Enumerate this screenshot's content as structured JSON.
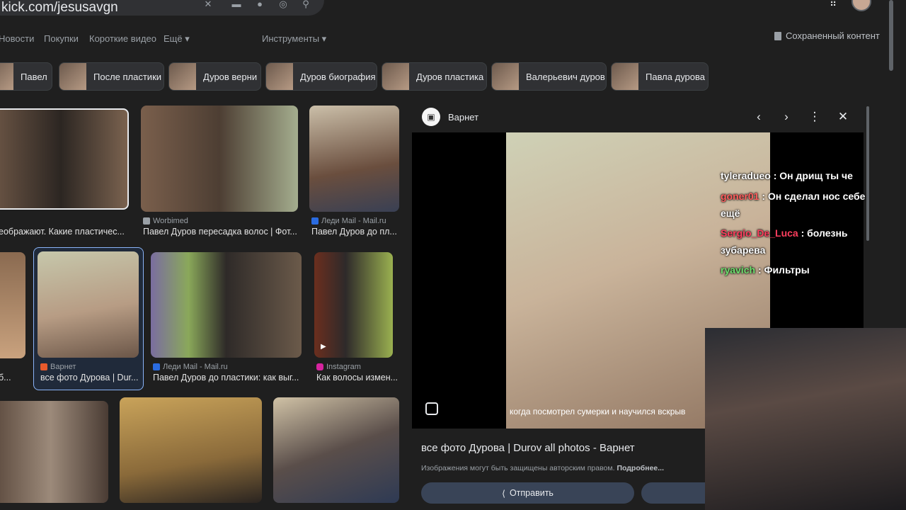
{
  "search": {
    "query": "kick.com/jesusavgn"
  },
  "header": {
    "icons": [
      "clear-icon",
      "keyboard-icon",
      "mic-icon",
      "lens-icon",
      "search-icon",
      "apps-grid-icon"
    ],
    "tabs": [
      "Новости",
      "Покупки",
      "Короткие видео",
      "Ещё ▾",
      "Инструменты ▾"
    ],
    "saved_label": "Сохраненный контент"
  },
  "chips": [
    "Павел",
    "После пластики",
    "Дуров верни",
    "Дуров биография",
    "Дуров пластика",
    "Валерьевич дуров",
    "Павла дурова"
  ],
  "results": {
    "row1": [
      {
        "source": "",
        "caption": "еображают. Какие пластичес..."
      },
      {
        "source": "Worbimed",
        "caption": "Павел Дуров пересадка волос | Фот..."
      },
      {
        "source": "Леди Mail - Mail.ru",
        "caption": "Павел Дуров до пл..."
      }
    ],
    "row2": [
      {
        "source": "",
        "caption": "б..."
      },
      {
        "source": "Варнет",
        "caption": "все фото Дурова | Dur..."
      },
      {
        "source": "Леди Mail - Mail.ru",
        "caption": "Павел Дуров до пластики: как выг..."
      },
      {
        "source": "Instagram",
        "caption": "Как волосы измен..."
      }
    ]
  },
  "panel": {
    "source": "Варнет",
    "logo_glyph": "▣",
    "controls": [
      "‹",
      "›",
      "⋮",
      "✕"
    ],
    "subtitle": "когда посмотрел сумерки и научился вскрыв",
    "title": "все фото Дурова | Durov all photos - Варнет",
    "copyright_note": "Изображения могут быть защищены авторским правом.",
    "more_link": "Подробнее...",
    "share_label": "Отправить",
    "share_glyph": "⟨"
  },
  "chat": [
    {
      "user": "tyleradueo",
      "text": ": Он дрищ ты че"
    },
    {
      "user": "goner01",
      "text": ": Он сделал нос себе"
    },
    {
      "user": "",
      "text": "ещё"
    },
    {
      "user": "Sergio_De_Luca",
      "text": ": болезнь"
    },
    {
      "user": "",
      "text": "зубарева"
    },
    {
      "user": "ryavich",
      "text": ": Фильтры"
    }
  ],
  "colors": {
    "background": "#1f1f1f",
    "accent": "#8ab4f8",
    "button": "#394457"
  }
}
